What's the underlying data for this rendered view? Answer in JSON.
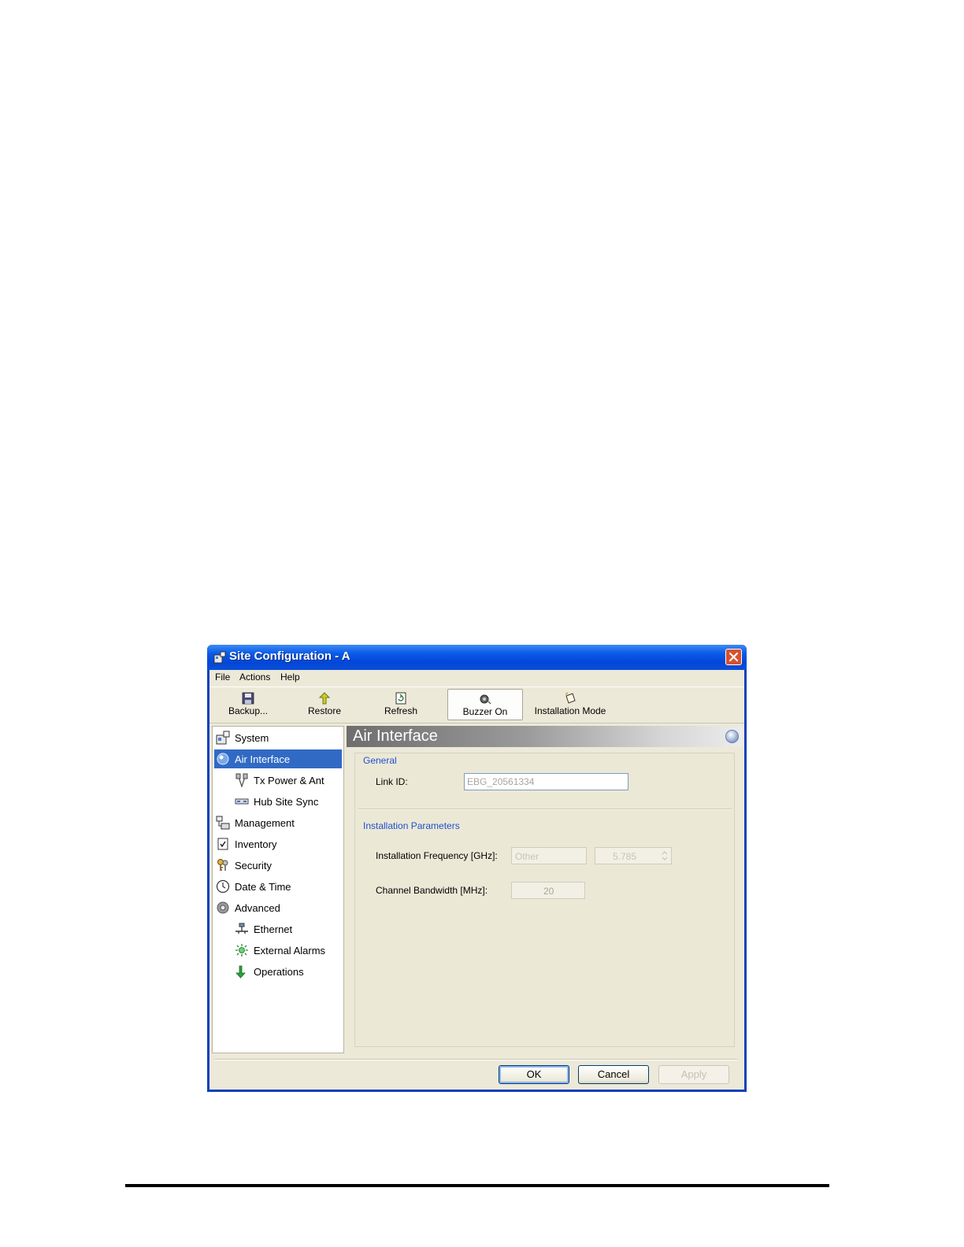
{
  "window": {
    "title": "Site Configuration - A"
  },
  "menu": [
    "File",
    "Actions",
    "Help"
  ],
  "toolbar": {
    "backup": "Backup...",
    "restore": "Restore",
    "refresh": "Refresh",
    "buzzer": "Buzzer On",
    "installation_mode": "Installation Mode"
  },
  "nav": {
    "system": "System",
    "air_interface": "Air Interface",
    "tx_power": "Tx Power & Ant",
    "hub_site_sync": "Hub Site Sync",
    "management": "Management",
    "inventory": "Inventory",
    "security": "Security",
    "date_time": "Date & Time",
    "advanced": "Advanced",
    "ethernet": "Ethernet",
    "external_alarms": "External Alarms",
    "operations": "Operations"
  },
  "content": {
    "title": "Air Interface",
    "general_label": "General",
    "link_id_label": "Link ID:",
    "link_id_value": "EBG_20561334",
    "install_params_label": "Installation Parameters",
    "install_freq_label": "Installation Frequency [GHz]:",
    "install_freq_select": "Other",
    "install_freq_value": "5.785",
    "channel_bw_label": "Channel Bandwidth [MHz]:",
    "channel_bw_value": "20"
  },
  "buttons": {
    "ok": "OK",
    "cancel": "Cancel",
    "apply": "Apply"
  },
  "colors": {
    "title_bar": "#0a5ae8",
    "selection": "#316ac5",
    "group_label": "#2050d0",
    "close_button": "#d8502e"
  }
}
